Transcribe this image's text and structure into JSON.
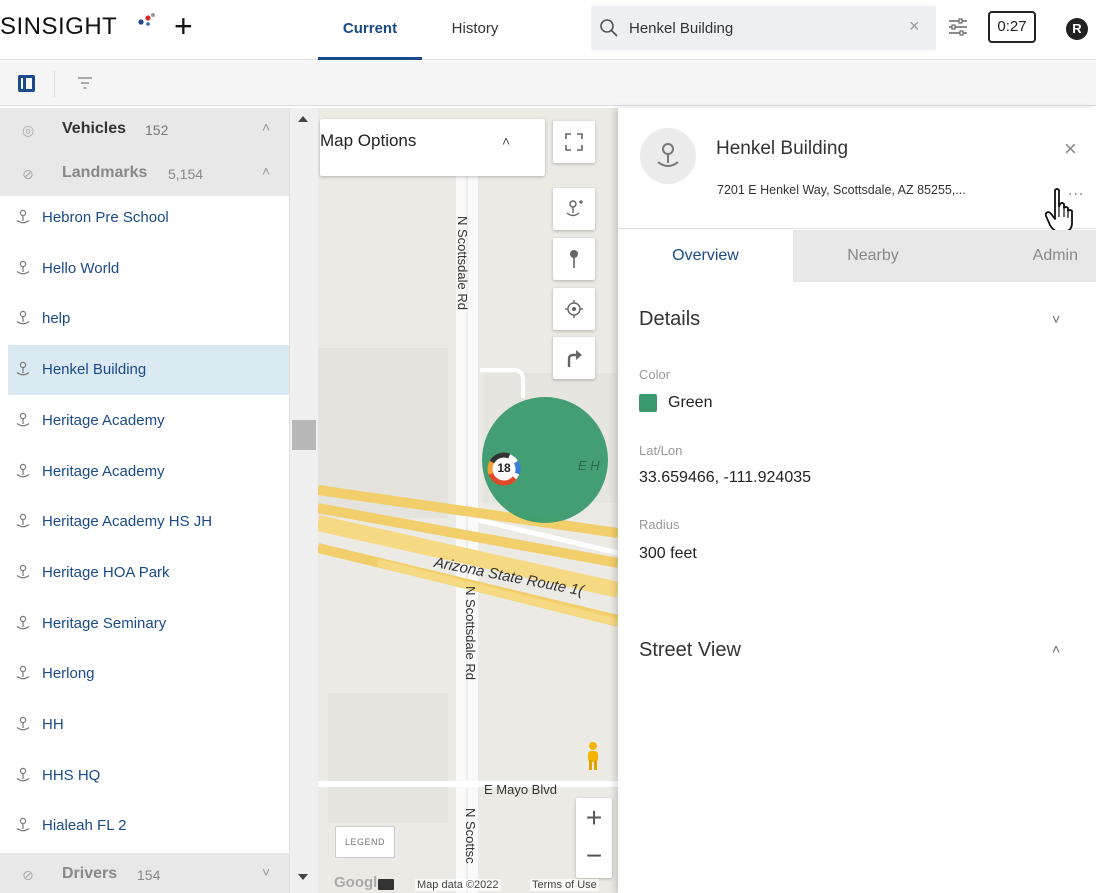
{
  "app": {
    "logo_text": "SINSIGHT",
    "plus": "+"
  },
  "nav": {
    "tabs": [
      {
        "label": "Current",
        "active": true
      },
      {
        "label": "History",
        "active": false
      }
    ]
  },
  "search": {
    "value": "Henkel Building",
    "clear": "×"
  },
  "timer": "0:27",
  "avatar_initial": "R",
  "colors": {
    "brand_blue": "#1a4a8a",
    "landmark_green": "#3a9a6e",
    "selected_row": "#dbe9f2"
  },
  "left_panel": {
    "groups": [
      {
        "name": "Vehicles",
        "count": "152"
      },
      {
        "name": "Landmarks",
        "count": "5,154"
      },
      {
        "name": "Drivers",
        "count": "154"
      }
    ],
    "landmarks": [
      {
        "label": "Hebron Pre School",
        "selected": false
      },
      {
        "label": "Hello World",
        "selected": false
      },
      {
        "label": "help",
        "selected": false
      },
      {
        "label": "Henkel Building",
        "selected": true
      },
      {
        "label": "Heritage Academy",
        "selected": false
      },
      {
        "label": "Heritage Academy",
        "selected": false
      },
      {
        "label": "Heritage Academy HS JH",
        "selected": false
      },
      {
        "label": "Heritage HOA Park",
        "selected": false
      },
      {
        "label": "Heritage Seminary",
        "selected": false
      },
      {
        "label": "Herlong",
        "selected": false
      },
      {
        "label": "HH",
        "selected": false
      },
      {
        "label": "HHS HQ",
        "selected": false
      },
      {
        "label": "Hialeah FL 2",
        "selected": false
      }
    ]
  },
  "map": {
    "options_label": "Map Options",
    "cluster_count": "18",
    "road_labels": {
      "scottsdale_north": "N Scottsdale Rd",
      "scottsdale_south": "N Scottsdale Rd",
      "scottsdale_bottom": "N Scottsc",
      "route": "Arizona State Route 1(",
      "mayo": "E Mayo Blvd",
      "henkel_fragment": "E H"
    },
    "legend": "LEGEND",
    "google": "Google",
    "map_data": "Map data ©2022",
    "terms": "Terms of Use",
    "zoom_in": "+",
    "zoom_out": "−"
  },
  "detail": {
    "title": "Henkel Building",
    "address": "7201 E Henkel Way, Scottsdale, AZ 85255,...",
    "more": "...",
    "close": "×",
    "tabs": [
      {
        "label": "Overview",
        "active": true
      },
      {
        "label": "Nearby",
        "active": false
      },
      {
        "label": "Admin",
        "active": false
      }
    ],
    "details_section": {
      "title": "Details",
      "color_label": "Color",
      "color_value": "Green",
      "latlon_label": "Lat/Lon",
      "latlon_value": "33.659466, -111.924035",
      "radius_label": "Radius",
      "radius_value": "300 feet"
    },
    "street_view": {
      "title": "Street View"
    }
  },
  "icons": {
    "search": "search-icon",
    "filter_settings": "sliders-icon",
    "panel_toggle": "panel-toggle-icon",
    "filter": "filter-icon",
    "landmark_pin": "landmark-pin-icon",
    "fullscreen": "fullscreen-icon",
    "add_landmark": "add-landmark-icon",
    "pin": "pin-icon",
    "locate": "locate-icon",
    "directions": "directions-icon",
    "pegman": "pegman-icon"
  }
}
